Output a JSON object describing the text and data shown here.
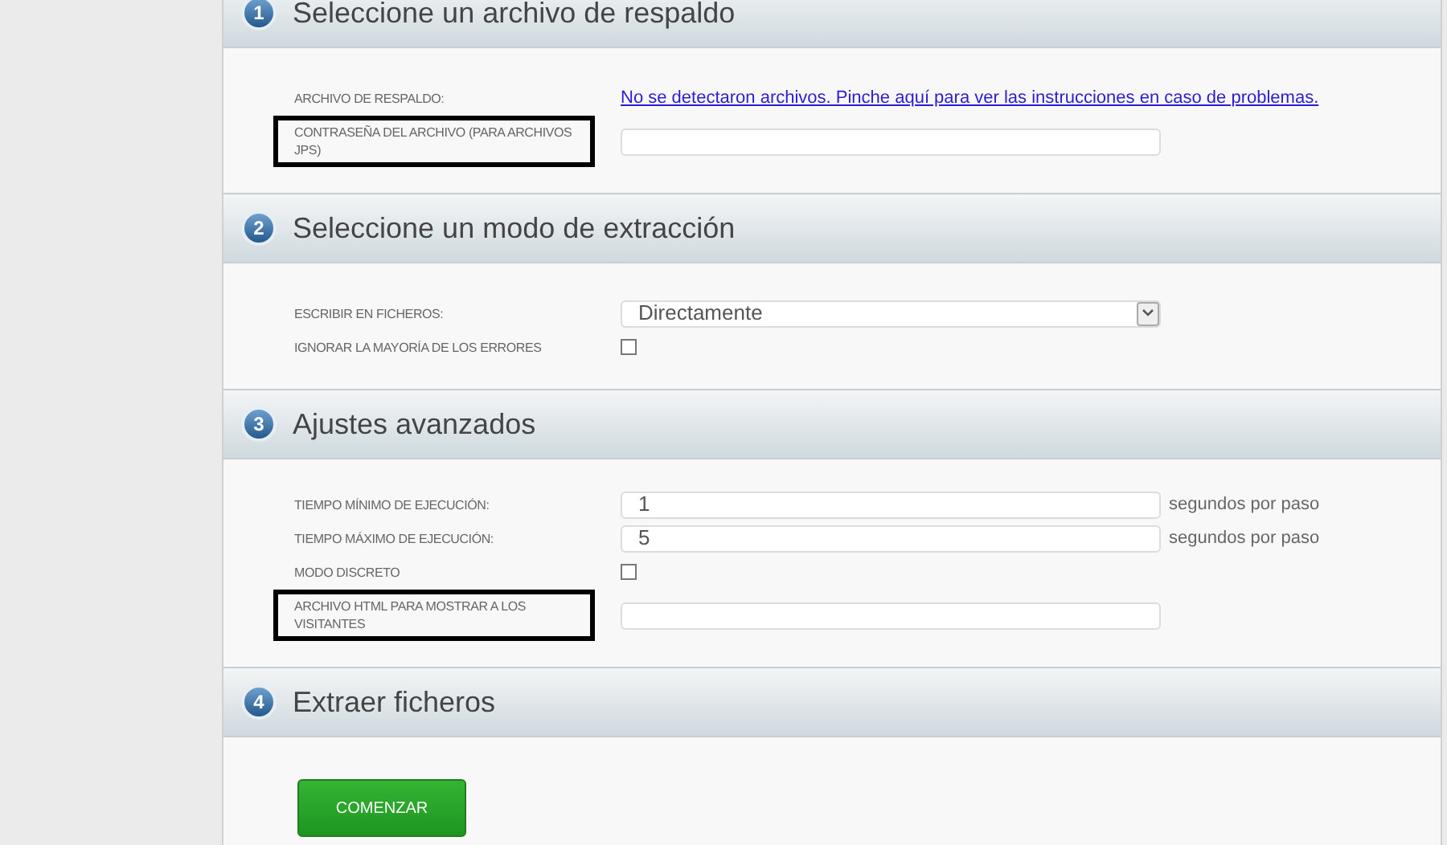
{
  "sections": [
    {
      "number": "1",
      "title": "Seleccione un archivo de respaldo",
      "rows": [
        {
          "kind": "link",
          "label": "ARCHIVO DE RESPALDO:",
          "highlighted": false,
          "link": "No se detectaron archivos. Pinche aquí para ver las instrucciones en caso de problemas."
        },
        {
          "kind": "field",
          "label": "CONTRASEÑA DEL ARCHIVO (PARA ARCHIVOS JPS)",
          "highlighted": true
        }
      ]
    },
    {
      "number": "2",
      "title": "Seleccione un modo de extracción",
      "rows": [
        {
          "kind": "select",
          "label": "ESCRIBIR EN FICHEROS:",
          "highlighted": false,
          "value": "Directamente"
        },
        {
          "kind": "checkbox",
          "label": "IGNORAR LA MAYORÍA DE LOS ERRORES",
          "highlighted": false,
          "checked": false
        }
      ]
    },
    {
      "number": "3",
      "title": "Ajustes avanzados",
      "rows": [
        {
          "kind": "field",
          "label": "TIEMPO MÍNIMO DE EJECUCIÓN:",
          "highlighted": false,
          "value": "1",
          "suffix": "segundos por paso"
        },
        {
          "kind": "field",
          "label": "TIEMPO MÁXIMO DE EJECUCIÓN:",
          "highlighted": false,
          "value": "5",
          "suffix": "segundos por paso"
        },
        {
          "kind": "checkbox",
          "label": "MODO DISCRETO",
          "highlighted": false,
          "checked": false
        },
        {
          "kind": "field",
          "label": "ARCHIVO HTML PARA MOSTRAR A LOS VISITANTES",
          "highlighted": true
        }
      ]
    },
    {
      "number": "4",
      "title": "Extraer ficheros",
      "button": "COMENZAR"
    }
  ]
}
